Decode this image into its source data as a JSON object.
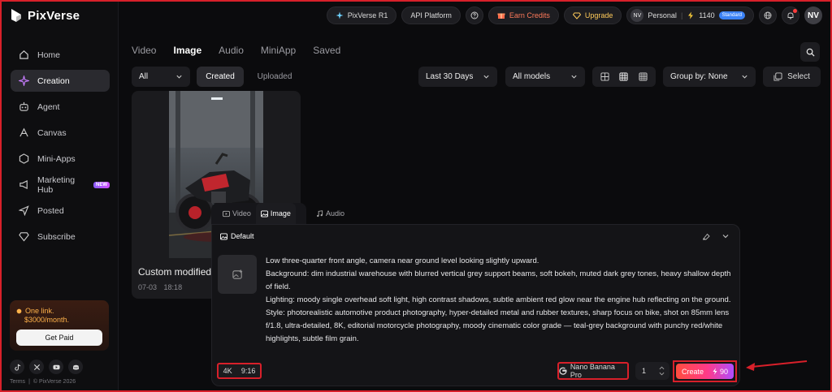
{
  "brand": {
    "name": "PixVerse"
  },
  "sidebar": {
    "items": [
      {
        "label": "Home",
        "icon": "home-icon"
      },
      {
        "label": "Creation",
        "icon": "sparkle-icon",
        "active": true
      },
      {
        "label": "Agent",
        "icon": "robot-icon"
      },
      {
        "label": "Canvas",
        "icon": "canvas-icon"
      },
      {
        "label": "Mini-Apps",
        "icon": "miniapps-icon"
      },
      {
        "label": "Marketing Hub",
        "icon": "megaphone-icon",
        "badge": "NEW"
      },
      {
        "label": "Posted",
        "icon": "send-icon"
      },
      {
        "label": "Subscribe",
        "icon": "diamond-icon"
      }
    ],
    "promo": {
      "line1": "One link.",
      "line2": "$3000/month.",
      "button": "Get Paid"
    },
    "footer": {
      "terms": "Terms",
      "sep": "|",
      "copyright": "© PixVerse 2026"
    }
  },
  "topbar": {
    "r1": "PixVerse R1",
    "api": "API Platform",
    "earn": "Earn Credits",
    "upgrade": "Upgrade",
    "account_initials": "NV",
    "account": "Personal",
    "credits": "1140",
    "plan": "Standard",
    "avatar": "NV"
  },
  "main": {
    "tabs": [
      "Video",
      "Image",
      "Audio",
      "MiniApp",
      "Saved"
    ],
    "active_tab": "Image",
    "filters": {
      "all": "All",
      "created": "Created",
      "uploaded": "Uploaded",
      "range": "Last 30 Days",
      "models": "All models",
      "group": "Group by: None",
      "select": "Select"
    },
    "card": {
      "title": "Custom modified",
      "date": "07-03",
      "time": "18:18"
    }
  },
  "panel": {
    "tabs": [
      "Video",
      "Image",
      "Audio"
    ],
    "active_tab": "Image",
    "preset": "Default",
    "prompt": "Low three-quarter front angle, camera near ground level looking slightly upward.\nBackground: dim industrial warehouse with blurred vertical grey support beams, soft bokeh, muted dark grey tones, heavy shallow depth of field.\nLighting: moody single overhead soft light, high contrast shadows, subtle ambient red glow near the engine hub reflecting on the ground.\nStyle: photorealistic automotive product photography, hyper-detailed metal and rubber textures, sharp focus on bike, shot on 85mm lens f/1.8, ultra-detailed, 8K, editorial motorcycle photography, moody cinematic color grade — teal-grey background with punchy red/white highlights, subtle film grain.",
    "resolution": "4K",
    "ratio": "9:16",
    "model": "Nano Banana Pro",
    "quantity": "1",
    "create": "Create",
    "cost": "90"
  },
  "colors": {
    "accent_red": "#d8202a",
    "create_gradient_start": "#ff4d3d",
    "create_gradient_end": "#b04dff"
  }
}
